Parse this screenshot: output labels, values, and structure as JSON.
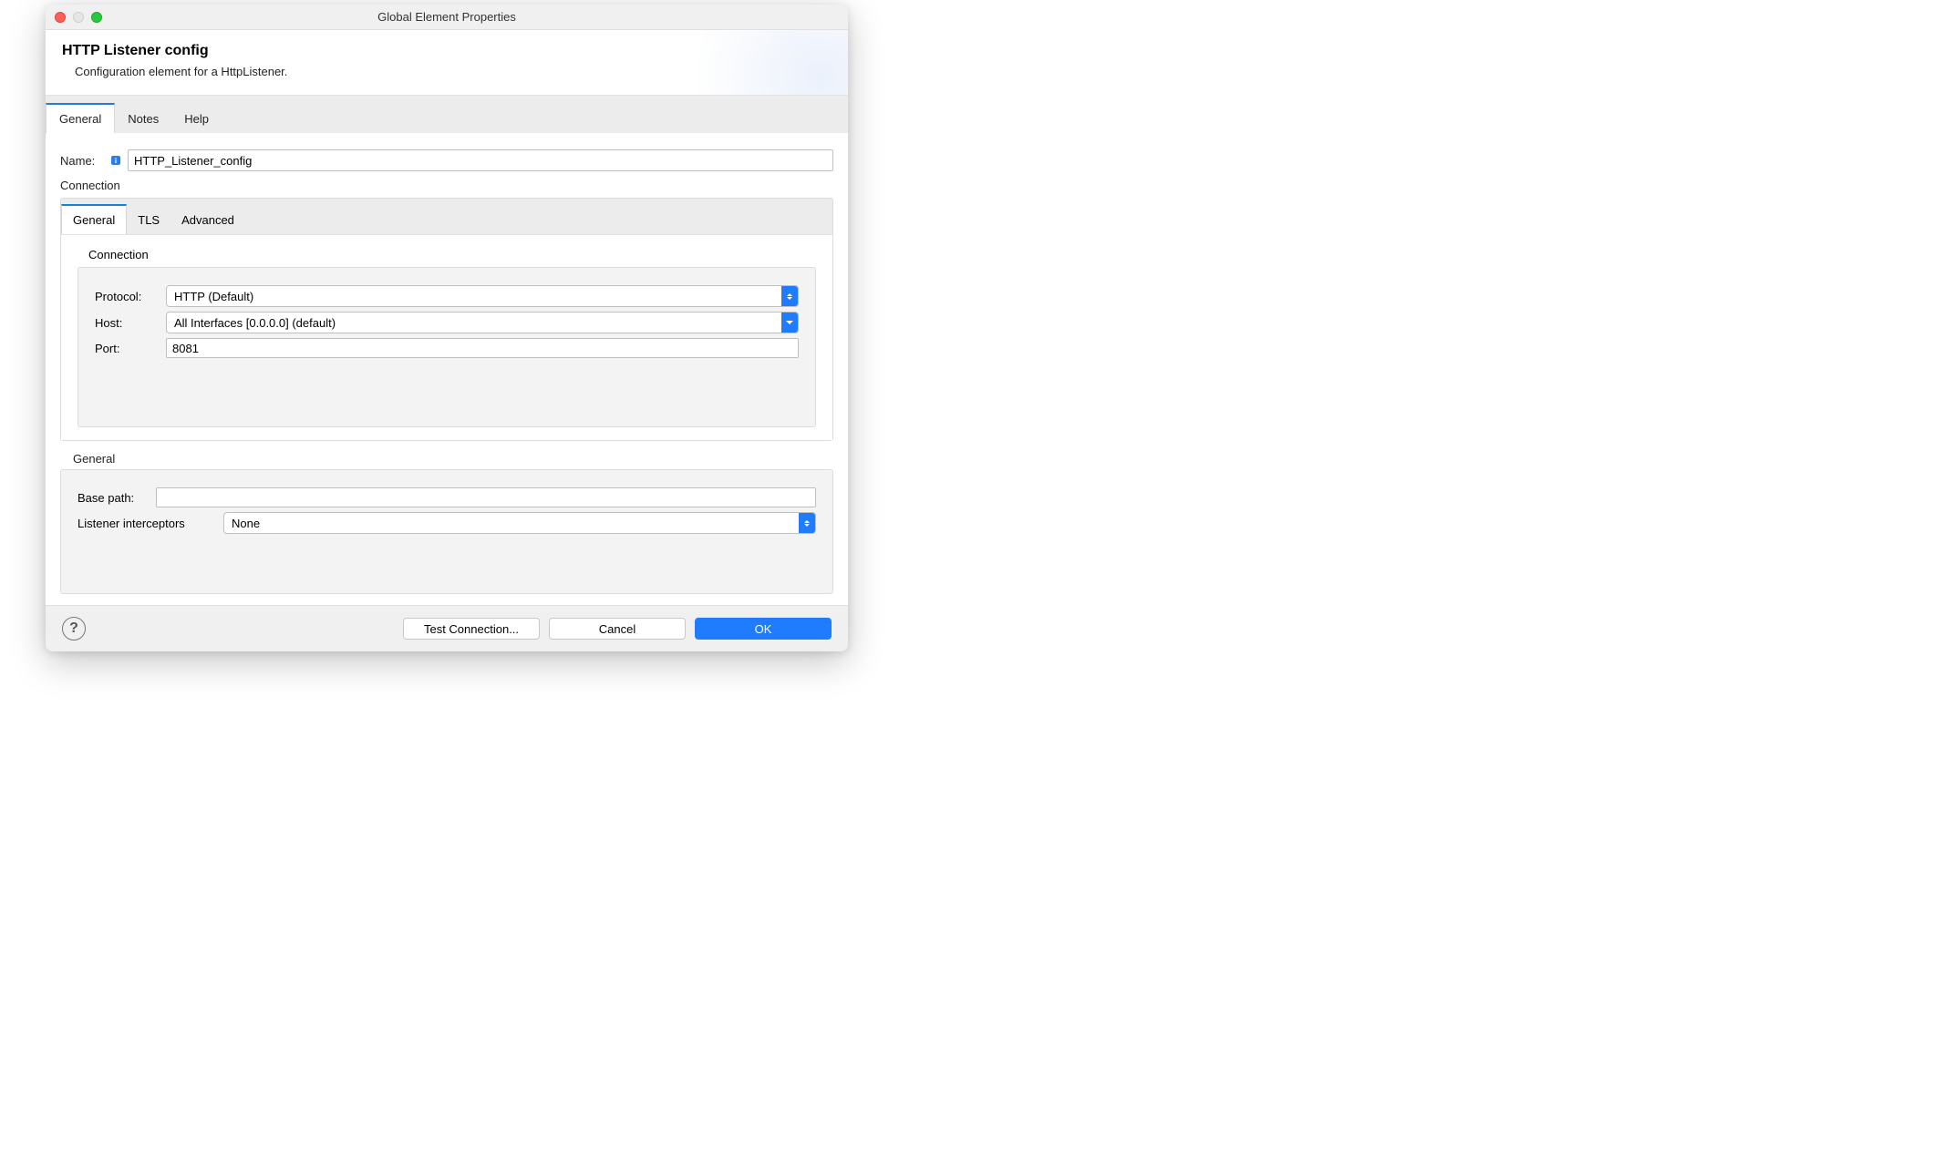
{
  "titlebar": {
    "title": "Global Element Properties"
  },
  "header": {
    "title": "HTTP Listener config",
    "subtitle": "Configuration element for a HttpListener."
  },
  "outer_tabs": {
    "items": [
      "General",
      "Notes",
      "Help"
    ],
    "active": 0
  },
  "name_field": {
    "label": "Name:",
    "value": "HTTP_Listener_config"
  },
  "connection_section": {
    "label": "Connection"
  },
  "inner_tabs": {
    "items": [
      "General",
      "TLS",
      "Advanced"
    ],
    "active": 0
  },
  "connection_fieldset": {
    "label": "Connection",
    "protocol_label": "Protocol:",
    "protocol_value": "HTTP (Default)",
    "host_label": "Host:",
    "host_value": "All Interfaces [0.0.0.0] (default)",
    "port_label": "Port:",
    "port_value": "8081"
  },
  "general_section": {
    "label": "General",
    "base_path_label": "Base path:",
    "base_path_value": "",
    "interceptors_label": "Listener interceptors",
    "interceptors_value": "None"
  },
  "footer": {
    "test_connection": "Test Connection...",
    "cancel": "Cancel",
    "ok": "OK"
  }
}
